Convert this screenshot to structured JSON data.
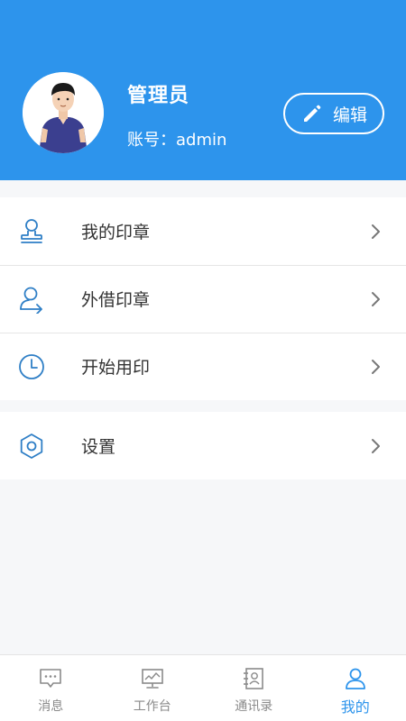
{
  "profile": {
    "name": "管理员",
    "account": "账号：admin",
    "edit_label": "编辑"
  },
  "menu": {
    "items": [
      {
        "label": "我的印章",
        "icon": "stamp-icon"
      },
      {
        "label": "外借印章",
        "icon": "user-out-icon"
      },
      {
        "label": "开始用印",
        "icon": "clock-icon"
      },
      {
        "label": "设置",
        "icon": "settings-hexagon-icon"
      }
    ]
  },
  "tabbar": {
    "tabs": [
      {
        "label": "消息",
        "icon": "message-icon",
        "active": false
      },
      {
        "label": "工作台",
        "icon": "monitor-icon",
        "active": false
      },
      {
        "label": "通讯录",
        "icon": "contacts-icon",
        "active": false
      },
      {
        "label": "我的",
        "icon": "person-icon",
        "active": true
      }
    ]
  },
  "colors": {
    "primary": "#2d94ec",
    "icon_blue": "#2f7fc6",
    "background": "#f6f7f9",
    "inactive_text": "#8a8a8a"
  }
}
